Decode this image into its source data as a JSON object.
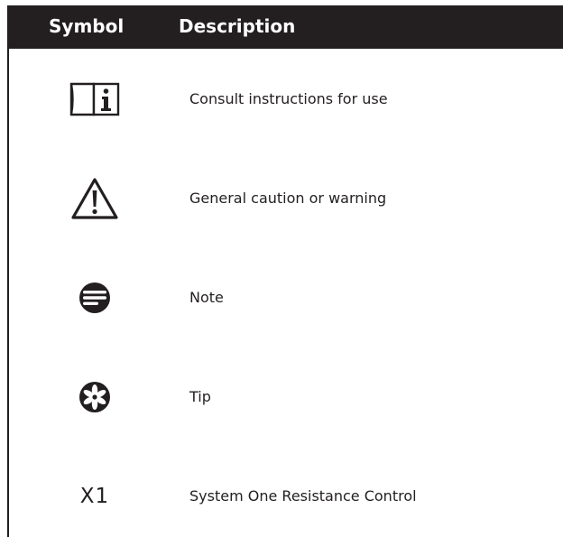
{
  "table": {
    "header": {
      "symbol": "Symbol",
      "description": "Description"
    },
    "rows": [
      {
        "icon": "consult-instructions-icon",
        "description": "Consult instructions for use"
      },
      {
        "icon": "caution-warning-icon",
        "description": "General caution or warning"
      },
      {
        "icon": "note-icon",
        "description": "Note"
      },
      {
        "icon": "tip-icon",
        "description": "Tip"
      },
      {
        "symbol_text": "X1",
        "description": "System One Resistance Control"
      }
    ]
  },
  "colors": {
    "ink": "#231f20",
    "header_background": "#231f20",
    "header_text": "#ffffff"
  }
}
